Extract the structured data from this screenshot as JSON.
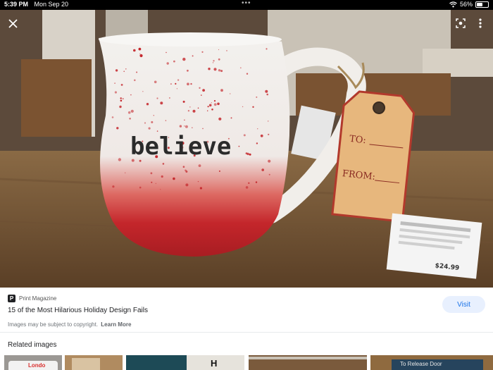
{
  "status_bar": {
    "time": "5:39 PM",
    "date": "Mon Sep 20",
    "battery": "56%",
    "battery_level": 0.56,
    "icons": [
      "wifi-icon",
      "battery-icon"
    ]
  },
  "viewer": {
    "mug_text": "believe",
    "tag_to": "TO:",
    "tag_from": "FROM:",
    "price_tag_price": "$24.99",
    "buttons": [
      "close-icon",
      "lens-icon",
      "more-vertical-icon"
    ]
  },
  "result": {
    "source_letter": "P",
    "source_name": "Print Magazine",
    "title": "15 of the Most Hilarious Holiday Design Fails",
    "visit_label": "Visit",
    "copyright_text": "Images may be subject to copyright.",
    "learn_more": "Learn More"
  },
  "related": {
    "heading": "Related images",
    "thumbs": [
      {
        "caption": "Londo"
      },
      {
        "caption": ""
      },
      {
        "caption": "H"
      },
      {
        "caption": ""
      },
      {
        "caption": "To Release Door"
      }
    ]
  },
  "colors": {
    "accent": "#1a73e8",
    "visit_bg": "#e8f0fe",
    "mug_red": "#c4262b"
  }
}
